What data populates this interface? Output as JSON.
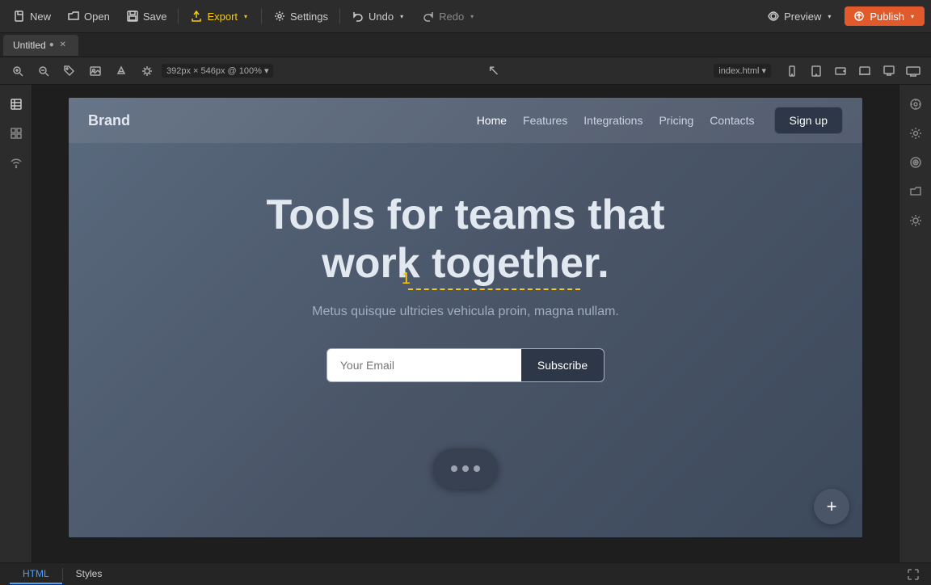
{
  "toolbar": {
    "new_label": "New",
    "open_label": "Open",
    "save_label": "Save",
    "export_label": "Export",
    "settings_label": "Settings",
    "undo_label": "Undo",
    "redo_label": "Redo",
    "preview_label": "Preview",
    "publish_label": "Publish"
  },
  "tab": {
    "name": "Untitled",
    "modified": true
  },
  "canvas": {
    "size": "392px × 546px @ 100%",
    "page": "index.html"
  },
  "webpage": {
    "brand": "Brand",
    "nav": {
      "links": [
        "Home",
        "Features",
        "Integrations",
        "Pricing",
        "Contacts"
      ],
      "active": "Home"
    },
    "signup_label": "Sign up",
    "hero": {
      "title_line1": "Tools for teams that",
      "title_line2": "work together.",
      "subtitle": "Metus quisque ultricies vehicula proin, magna nullam.",
      "email_placeholder": "Your Email",
      "subscribe_label": "Subscribe"
    }
  },
  "bottom_bar": {
    "tabs": [
      "HTML",
      "Styles"
    ]
  },
  "icons": {
    "new": "📄",
    "open": "📂",
    "save": "💾",
    "export": "⬆",
    "settings": "⚙",
    "undo": "↩",
    "redo": "↪",
    "preview": "👁",
    "zoom_in": "+",
    "zoom_out": "−",
    "tag": "#",
    "image": "🖼",
    "layers": "≡",
    "components": "⊞",
    "wifi": "📶",
    "cursor": "↖",
    "color": "🎨",
    "gear": "⚙",
    "target": "◎",
    "folder": "📁",
    "sun": "☀"
  }
}
